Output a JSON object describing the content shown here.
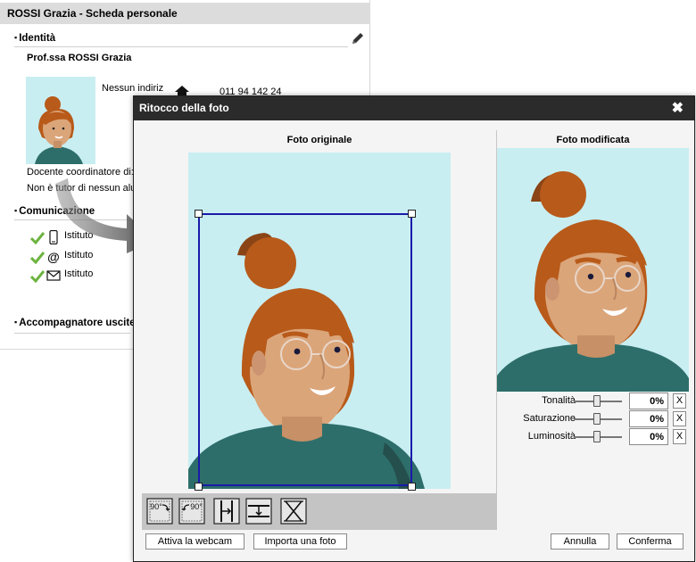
{
  "card": {
    "title": "ROSSI Grazia - Scheda personale",
    "section_identity": "Identità",
    "name": "Prof.ssa ROSSI Grazia",
    "address_text": "Nessun indiriz",
    "phone": "011 94 142 24",
    "coordinator_text": "Docente coordinatore di:",
    "tutor_text": "Non è tutor di nessun alu",
    "section_communication": "Comunicazione",
    "comm_items": [
      {
        "icon": "phone-icon",
        "label": "Istituto"
      },
      {
        "icon": "at-icon",
        "label": "Istituto"
      },
      {
        "icon": "envelope-icon",
        "label": "Istituto"
      }
    ],
    "section_companion": "Accompagnatore uscite"
  },
  "dialog": {
    "title": "Ritocco della foto",
    "close_glyph": "✖",
    "original_title": "Foto originale",
    "modified_title": "Foto modificata",
    "sliders": [
      {
        "label": "Tonalità",
        "value": "0",
        "unit": "%",
        "reset": "X"
      },
      {
        "label": "Saturazione",
        "value": "0",
        "unit": "%",
        "reset": "X"
      },
      {
        "label": "Luminosità",
        "value": "0",
        "unit": "%",
        "reset": "X"
      }
    ],
    "toolbar": {
      "rotate_left_label": "90°",
      "rotate_right_label": "90°"
    },
    "webcam_button": "Attiva la webcam",
    "import_button": "Importa una foto",
    "cancel_button": "Annulla",
    "confirm_button": "Conferma"
  },
  "colors": {
    "photo_bg": "#c8eef2",
    "hair": "#b85a1a",
    "skin": "#dba57a",
    "shirt": "#2e6e6a",
    "crop_border": "#1a1aa8",
    "check_green": "#6cb33f"
  }
}
